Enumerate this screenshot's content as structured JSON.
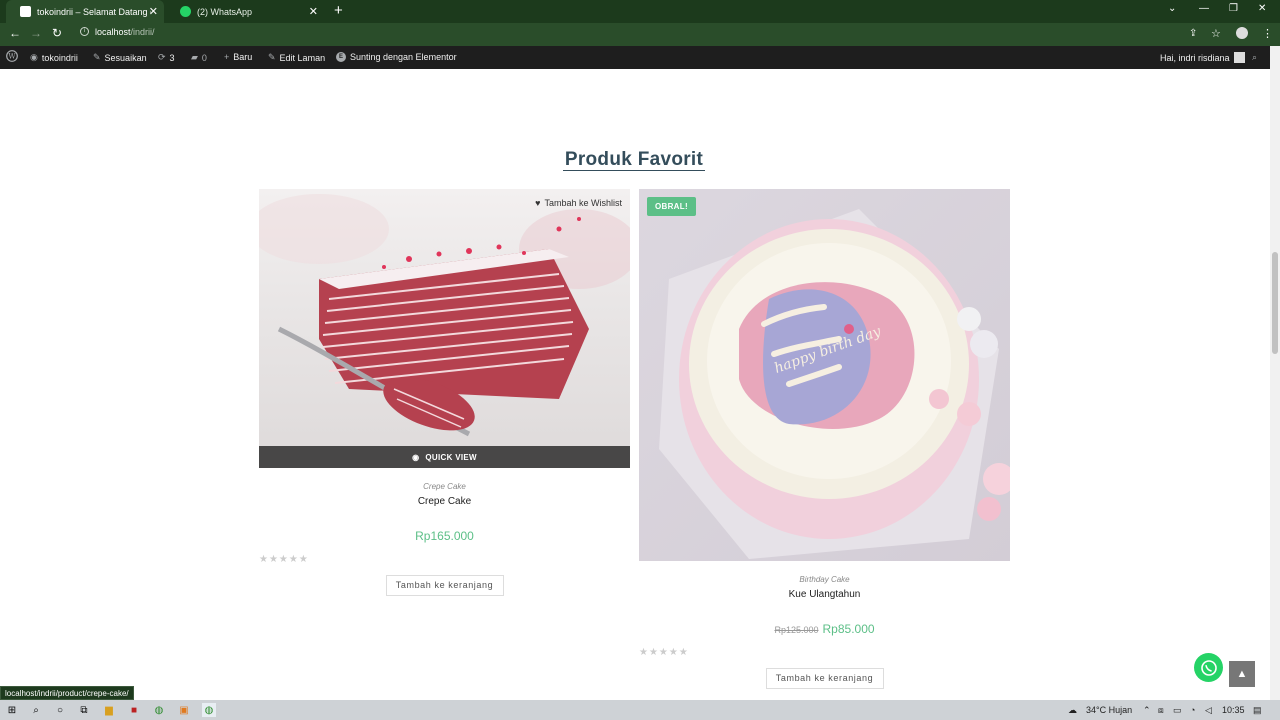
{
  "browser": {
    "tabs": [
      {
        "title": "tokoindrii – Selamat Datang di to",
        "active": true
      },
      {
        "title": "(2) WhatsApp",
        "active": false
      }
    ],
    "address": {
      "host": "localhost",
      "path": "/indrii/"
    }
  },
  "adminbar": {
    "site": "tokoindrii",
    "customize": "Sesuaikan",
    "updates": "3",
    "comments": "0",
    "new": "Baru",
    "edit_page": "Edit Laman",
    "elementor": "Sunting dengan Elementor",
    "greeting": "Hai, indri risdiana"
  },
  "section": {
    "title": "Produk Favorit"
  },
  "products": [
    {
      "category": "Crepe Cake",
      "name": "Crepe Cake",
      "price": "Rp165.000",
      "old_price": "",
      "wishlist": "Tambah ke Wishlist",
      "quick_view": "QUICK VIEW",
      "badge": "",
      "add_to_cart": "Tambah ke keranjang",
      "rating": 0
    },
    {
      "category": "Birthday Cake",
      "name": "Kue Ulangtahun",
      "price": "Rp85.000",
      "old_price": "Rp125.000",
      "badge": "OBRAL!",
      "add_to_cart": "Tambah ke keranjang",
      "rating": 0,
      "cake_text": "happy birth day"
    }
  ],
  "status_url": "localhost/indrii/product/crepe-cake/",
  "taskbar": {
    "weather": "34°C Hujan",
    "time": "10:35"
  },
  "colors": {
    "accent_green": "#5cbf87",
    "title": "#344d5b",
    "browser": "#2a4d2a"
  }
}
